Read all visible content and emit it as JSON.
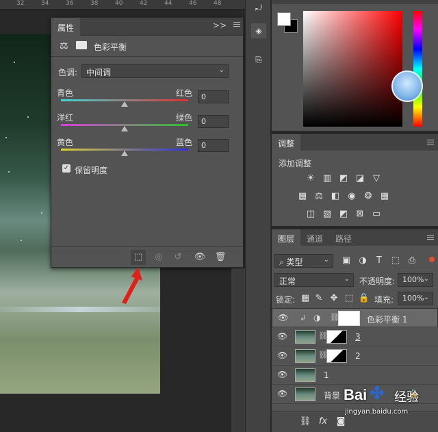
{
  "ruler": {
    "ticks": [
      "32",
      "34",
      "36",
      "38",
      "40",
      "42",
      "44",
      "46",
      "48"
    ]
  },
  "properties": {
    "tab": "属性",
    "collapse": ">>",
    "title": "色彩平衡",
    "tone_label": "色调:",
    "tone_value": "中间调",
    "sliders": [
      {
        "left": "青色",
        "right": "红色",
        "value": "0",
        "gradient": [
          "#3fd6d6",
          "#e03030"
        ]
      },
      {
        "left": "洋红",
        "right": "绿色",
        "value": "0",
        "gradient": [
          "#d63fd6",
          "#30c030"
        ]
      },
      {
        "left": "黄色",
        "right": "蓝色",
        "value": "0",
        "gradient": [
          "#e0d030",
          "#3030e0"
        ]
      }
    ],
    "preserve_label": "保留明度",
    "preserve_checked": true
  },
  "adjustments": {
    "tab": "调整",
    "subtitle": "添加调整"
  },
  "layers_panel": {
    "tabs": [
      "图层",
      "通道",
      "路径"
    ],
    "filter": "类型",
    "blend_mode": "正常",
    "opacity_label": "不透明度:",
    "opacity_value": "100%",
    "lock_label": "锁定:",
    "fill_label": "填充:",
    "fill_value": "100%",
    "layers": [
      {
        "name": "色彩平衡 1",
        "selected": true
      },
      {
        "name": "3",
        "selected": false
      },
      {
        "name": "2",
        "selected": false
      },
      {
        "name": "1",
        "selected": false
      },
      {
        "name": "背景",
        "selected": false
      }
    ],
    "footer_fx": "fx"
  },
  "watermark": {
    "brand": "Bai",
    "sub": "经验",
    "url": "jingyan.baidu.com"
  },
  "colors": {
    "accent": "#e03030",
    "panel": "#535353",
    "dark": "#282828"
  }
}
